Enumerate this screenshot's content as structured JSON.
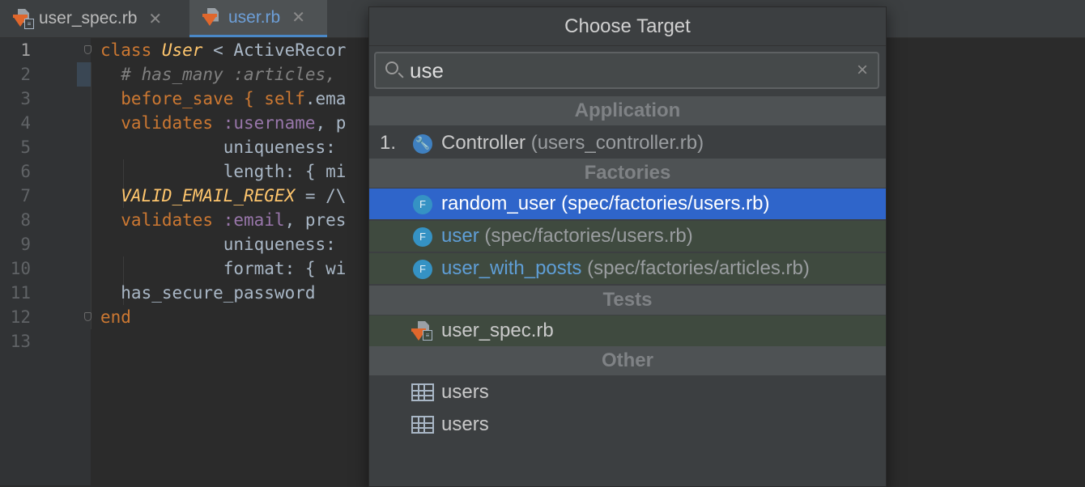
{
  "tabs": [
    {
      "label": "user_spec.rb",
      "active": false
    },
    {
      "label": "user.rb",
      "active": true
    }
  ],
  "editor": {
    "lines": [
      {
        "num": "1",
        "segments": [
          {
            "t": "class ",
            "c": "kw"
          },
          {
            "t": "User",
            "c": "cls"
          },
          {
            "t": " < ActiveRecor",
            "c": ""
          }
        ]
      },
      {
        "num": "2",
        "segments": [
          {
            "t": "  # has_many :articles, ",
            "c": "cm"
          }
        ]
      },
      {
        "num": "3",
        "segments": [
          {
            "t": "  before_save { ",
            "c": "kw"
          },
          {
            "t": "self",
            "c": "kw"
          },
          {
            "t": ".ema",
            "c": ""
          }
        ]
      },
      {
        "num": "4",
        "segments": [
          {
            "t": "  validates ",
            "c": "kw"
          },
          {
            "t": ":username",
            "c": "sym"
          },
          {
            "t": ", p",
            "c": ""
          }
        ]
      },
      {
        "num": "5",
        "segments": [
          {
            "t": "            uniqueness: ",
            "c": ""
          }
        ]
      },
      {
        "num": "6",
        "segments": [
          {
            "t": "            length: { mi",
            "c": ""
          }
        ]
      },
      {
        "num": "7",
        "segments": [
          {
            "t": "  VALID_EMAIL_REGEX",
            "c": "const"
          },
          {
            "t": " = /\\",
            "c": ""
          }
        ]
      },
      {
        "num": "8",
        "segments": [
          {
            "t": "  validates ",
            "c": "kw"
          },
          {
            "t": ":email",
            "c": "sym"
          },
          {
            "t": ", pres",
            "c": ""
          }
        ]
      },
      {
        "num": "9",
        "segments": [
          {
            "t": "            uniqueness: ",
            "c": ""
          }
        ]
      },
      {
        "num": "10",
        "segments": [
          {
            "t": "            format: { wi",
            "c": ""
          }
        ]
      },
      {
        "num": "11",
        "segments": [
          {
            "t": "  has_secure_password",
            "c": ""
          }
        ]
      },
      {
        "num": "12",
        "segments": [
          {
            "t": "end",
            "c": "kw"
          }
        ]
      },
      {
        "num": "13",
        "segments": []
      }
    ]
  },
  "popup": {
    "title": "Choose Target",
    "search_value": "use",
    "clear_glyph": "×",
    "sections": {
      "application": "Application",
      "factories": "Factories",
      "tests": "Tests",
      "other": "Other"
    },
    "items": {
      "controller": {
        "num": "1.",
        "name": "Controller",
        "path": "(users_controller.rb)",
        "icon": "wrench-icon"
      },
      "random_user": {
        "name": "random_user",
        "path": "(spec/factories/users.rb)",
        "icon": "factory-icon"
      },
      "user": {
        "name": "user",
        "path": "(spec/factories/users.rb)",
        "icon": "factory-icon"
      },
      "user_with_posts": {
        "name": "user_with_posts",
        "path": "(spec/factories/articles.rb)",
        "icon": "factory-icon"
      },
      "user_spec": {
        "name": "user_spec.rb",
        "icon": "ruby-test-file-icon"
      },
      "users_1": {
        "name": "users",
        "icon": "table-icon"
      },
      "users_2": {
        "name": "users",
        "icon": "table-icon"
      }
    },
    "factory_letter": "F"
  },
  "colors": {
    "selection": "#2f65ca",
    "keyword": "#cc7832",
    "class_name": "#ffc66d",
    "symbol": "#9876aa",
    "link_blue": "#5f9ed6"
  }
}
